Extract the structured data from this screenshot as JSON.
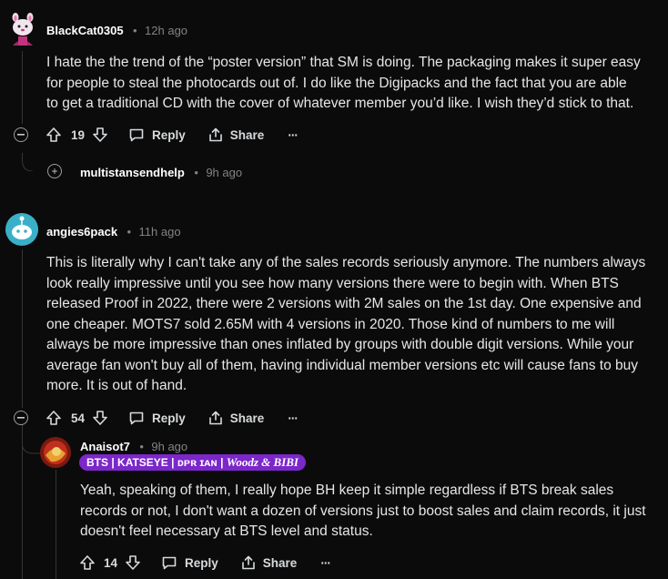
{
  "comments": [
    {
      "username": "BlackCat0305",
      "separator": "•",
      "time": "12h ago",
      "lines": [
        "I hate the the trend of the “poster version” that SM is doing. The packaging makes it super easy",
        "for people to steal the photocards out of. I do like the Digipacks and the fact that you are able",
        "to get a traditional CD with the cover of whatever member you’d like. I wish they’d stick to that."
      ],
      "votes": "19",
      "reply_label": "Reply",
      "share_label": "Share",
      "more_label": "···",
      "collapse_symbol": "⊖",
      "avatar_color": "#e8d0e0"
    },
    {
      "username": "multistansendhelp",
      "separator": "•",
      "time": "9h ago",
      "expand_symbol": "+"
    },
    {
      "username": "angies6pack",
      "separator": "•",
      "time": "11h ago",
      "lines": [
        "This is literally why I can't take any of the sales records seriously anymore. The numbers always",
        "look really impressive until you see how many versions there were to begin with. When BTS",
        "released Proof in 2022, there were 2 versions with 2M sales on the 1st day. One expensive and",
        "one cheaper. MOTS7 sold 2.65M with 4 versions in 2020. Those kind of numbers to me will",
        "always be more impressive than ones inflated by groups with double digit versions. While your",
        "average fan won't buy all of them, having individual member versions etc will cause fans to buy",
        "more. It is out of hand."
      ],
      "votes": "54",
      "reply_label": "Reply",
      "share_label": "Share",
      "more_label": "···",
      "avatar_color": "#3ab0c8"
    },
    {
      "username": "Anaisot7",
      "separator": "•",
      "time": "9h ago",
      "flair_main": "BTS | KATSEYE | ᴅᴘʀ ɪᴀɴ | ",
      "flair_italic": "Woodz & BIBI",
      "lines": [
        "Yeah, speaking of them, I really hope BH keep it simple regardless if BTS break sales",
        "records or not, I don't want a dozen of versions just to boost sales and claim records, it just",
        "doesn't feel necessary at BTS level and status."
      ],
      "votes": "14",
      "reply_label": "Reply",
      "share_label": "Share",
      "more_label": "···",
      "avatar_color": "#c0301c"
    }
  ],
  "colors": {
    "background": "#0b0b0b",
    "text": "#e6e6e6",
    "muted": "#818384",
    "flair": "#7b27c9"
  }
}
